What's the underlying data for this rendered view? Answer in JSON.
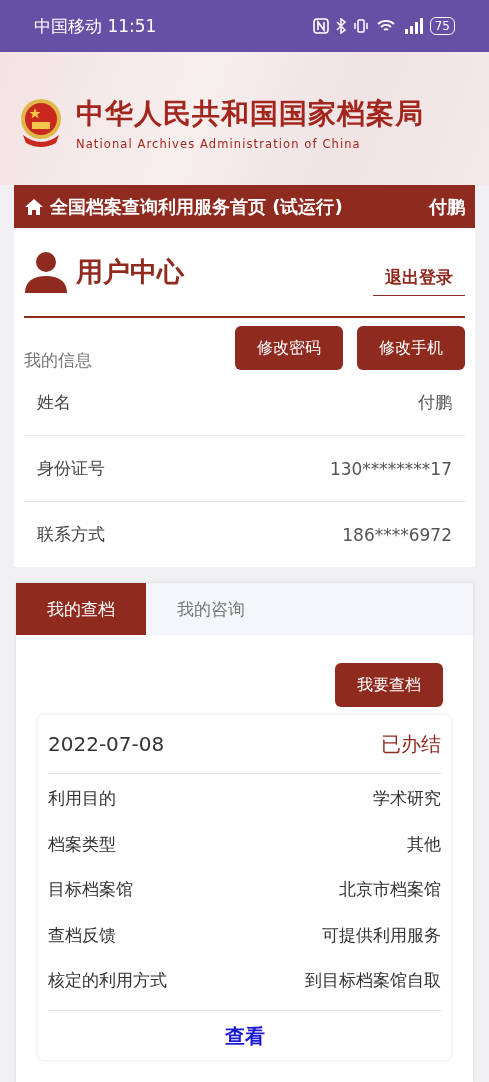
{
  "status_bar": {
    "carrier_time": "中国移动 11:51",
    "battery": "75"
  },
  "header": {
    "title": "中华人民共和国国家档案局",
    "subtitle": "National Archives Administration of China"
  },
  "nav": {
    "title": "全国档案查询利用服务首页 (试运行)",
    "user": "付鹏"
  },
  "user_center": {
    "title": "用户中心",
    "logout": "退出登录",
    "section": "我的信息",
    "buttons": [
      "修改密码",
      "修改手机"
    ],
    "fields": [
      {
        "label": "姓名",
        "value": "付鹏"
      },
      {
        "label": "身份证号",
        "value": "130********17"
      },
      {
        "label": "联系方式",
        "value": "186****6972"
      }
    ]
  },
  "tabs": [
    {
      "label": "我的查档",
      "selected": true
    },
    {
      "label": "我的咨询",
      "selected": false
    }
  ],
  "action_button": "我要查档",
  "record": {
    "date": "2022-07-08",
    "status": "已办结",
    "fields": [
      {
        "label": "利用目的",
        "value": "学术研究"
      },
      {
        "label": "档案类型",
        "value": "其他"
      },
      {
        "label": "目标档案馆",
        "value": "北京市档案馆"
      },
      {
        "label": "查档反馈",
        "value": "可提供利用服务"
      },
      {
        "label": "核定的利用方式",
        "value": "到目标档案馆自取"
      }
    ],
    "view": "查看"
  }
}
